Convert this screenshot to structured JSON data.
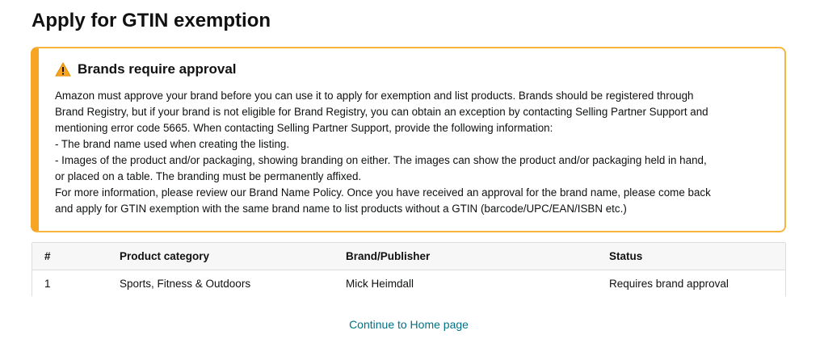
{
  "page": {
    "title": "Apply for GTIN exemption"
  },
  "alert": {
    "icon": "warning-icon",
    "title": "Brands require approval",
    "lines": [
      "Amazon must approve your brand before you can use it to apply for exemption and list products. Brands should be registered through",
      "Brand Registry, but if your brand is not eligible for Brand Registry, you can obtain an exception by contacting Selling Partner Support and",
      "mentioning error code 5665. When contacting Selling Partner Support, provide the following information:",
      "- The brand name used when creating the listing.",
      "- Images of the product and/or packaging, showing branding on either. The images can show the product and/or packaging held in hand,",
      "or placed on a table. The branding must be permanently affixed.",
      "For more information, please review our Brand Name Policy. Once you have received an approval for the brand name, please come back",
      "and apply for GTIN exemption with the same brand name to list products without a GTIN (barcode/UPC/EAN/ISBN etc.)"
    ],
    "colors": {
      "border": "#f7b53b",
      "accent": "#f7a523"
    }
  },
  "table": {
    "headers": [
      "#",
      "Product category",
      "Brand/Publisher",
      "Status"
    ],
    "rows": [
      [
        "1",
        "Sports, Fitness & Outdoors",
        "Mick Heimdall",
        "Requires brand approval"
      ]
    ]
  },
  "footer": {
    "continue_link": "Continue to Home page",
    "link_color": "#007185"
  }
}
